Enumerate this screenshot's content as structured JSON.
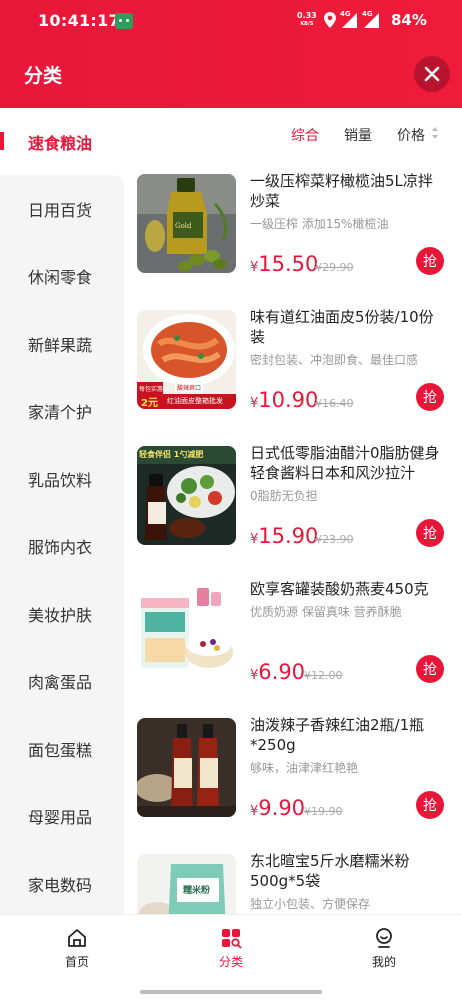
{
  "status_bar": {
    "time": "10:41:17",
    "speed_value": "0.33",
    "speed_unit": "KB/S",
    "network_1": "4G",
    "network_2": "4G",
    "battery": "84%"
  },
  "header": {
    "title": "分类",
    "close_icon": "close-icon"
  },
  "sidebar": {
    "active": "速食粮油",
    "items": [
      "日用百货",
      "休闲零食",
      "新鲜果蔬",
      "家清个护",
      "乳品饮料",
      "服饰内衣",
      "美妆护肤",
      "肉禽蛋品",
      "面包蛋糕",
      "母婴用品",
      "家电数码"
    ]
  },
  "sort": {
    "comprehensive": "综合",
    "sales": "销量",
    "price": "价格"
  },
  "products": [
    {
      "title": "一级压榨菜籽橄榄油5L凉拌炒菜",
      "subtitle": "一级压榨 添加15%橄榄油",
      "currency": "¥",
      "price": "15.50",
      "original_price": "¥29.90",
      "button": "抢"
    },
    {
      "title": "味有道红油面皮5份装/10份装",
      "subtitle": "密封包装、冲泡即食、最佳口感",
      "currency": "¥",
      "price": "10.90",
      "original_price": "¥16.40",
      "button": "抢",
      "image_badge_top": "每包实惠",
      "image_badge_price": "2元",
      "image_caption_1": "酸辣爽口",
      "image_caption_2": "红油面皮整箱批发"
    },
    {
      "title": "日式低零脂油醋汁0脂肪健身轻食酱料日本和风沙拉汁",
      "subtitle": "0脂肪无负担",
      "currency": "¥",
      "price": "15.90",
      "original_price": "¥23.90",
      "button": "抢",
      "image_caption": "轻食伴侣 1勺减肥"
    },
    {
      "title": "欧享客罐装酸奶燕麦450克",
      "subtitle": "优质奶源 保留真味 营养酥脆",
      "currency": "¥",
      "price": "6.90",
      "original_price": "¥12.00",
      "button": "抢"
    },
    {
      "title": "油泼辣子香辣红油2瓶/1瓶*250g",
      "subtitle": "够味，油津津红艳艳",
      "currency": "¥",
      "price": "9.90",
      "original_price": "¥19.90",
      "button": "抢"
    },
    {
      "title": "东北暄宝5斤水磨糯米粉500g*5袋",
      "subtitle": "独立小包装、方便保存",
      "image_caption": "糯米粉"
    }
  ],
  "bottom_nav": {
    "home": "首页",
    "category": "分类",
    "mine": "我的"
  },
  "colors": {
    "brand_red": "#e8173a",
    "sidebar_bg": "#f5f5f5",
    "muted_text": "#999999"
  }
}
